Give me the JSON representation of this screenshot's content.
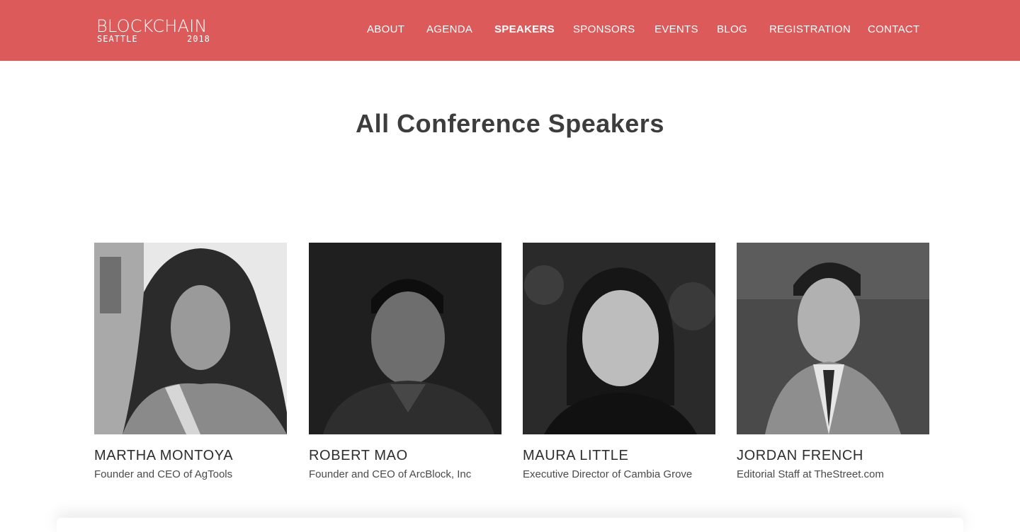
{
  "header": {
    "logo": {
      "title": "BLOCKCHAIN",
      "city": "SEATTLE",
      "year": "2018"
    },
    "background_color": "#dc5a5a",
    "nav": [
      {
        "label": "ABOUT",
        "active": false
      },
      {
        "label": "AGENDA",
        "active": false
      },
      {
        "label": "SPEAKERS",
        "active": true
      },
      {
        "label": "SPONSORS",
        "active": false
      },
      {
        "label": "EVENTS",
        "active": false
      },
      {
        "label": "BLOG",
        "active": false
      },
      {
        "label": "REGISTRATION",
        "active": false
      },
      {
        "label": "CONTACT",
        "active": false
      }
    ]
  },
  "main": {
    "title": "All Conference Speakers",
    "speakers": [
      {
        "name": "MARTHA MONTOYA",
        "role": "Founder and CEO of AgTools",
        "photo": "grayscale-portrait"
      },
      {
        "name": "ROBERT MAO",
        "role": "Founder and CEO of ArcBlock, Inc",
        "photo": "grayscale-portrait"
      },
      {
        "name": "MAURA LITTLE",
        "role": "Executive Director of Cambia Grove",
        "photo": "grayscale-portrait"
      },
      {
        "name": "JORDAN FRENCH",
        "role": "Editorial Staff at TheStreet.com",
        "photo": "grayscale-portrait"
      }
    ]
  }
}
